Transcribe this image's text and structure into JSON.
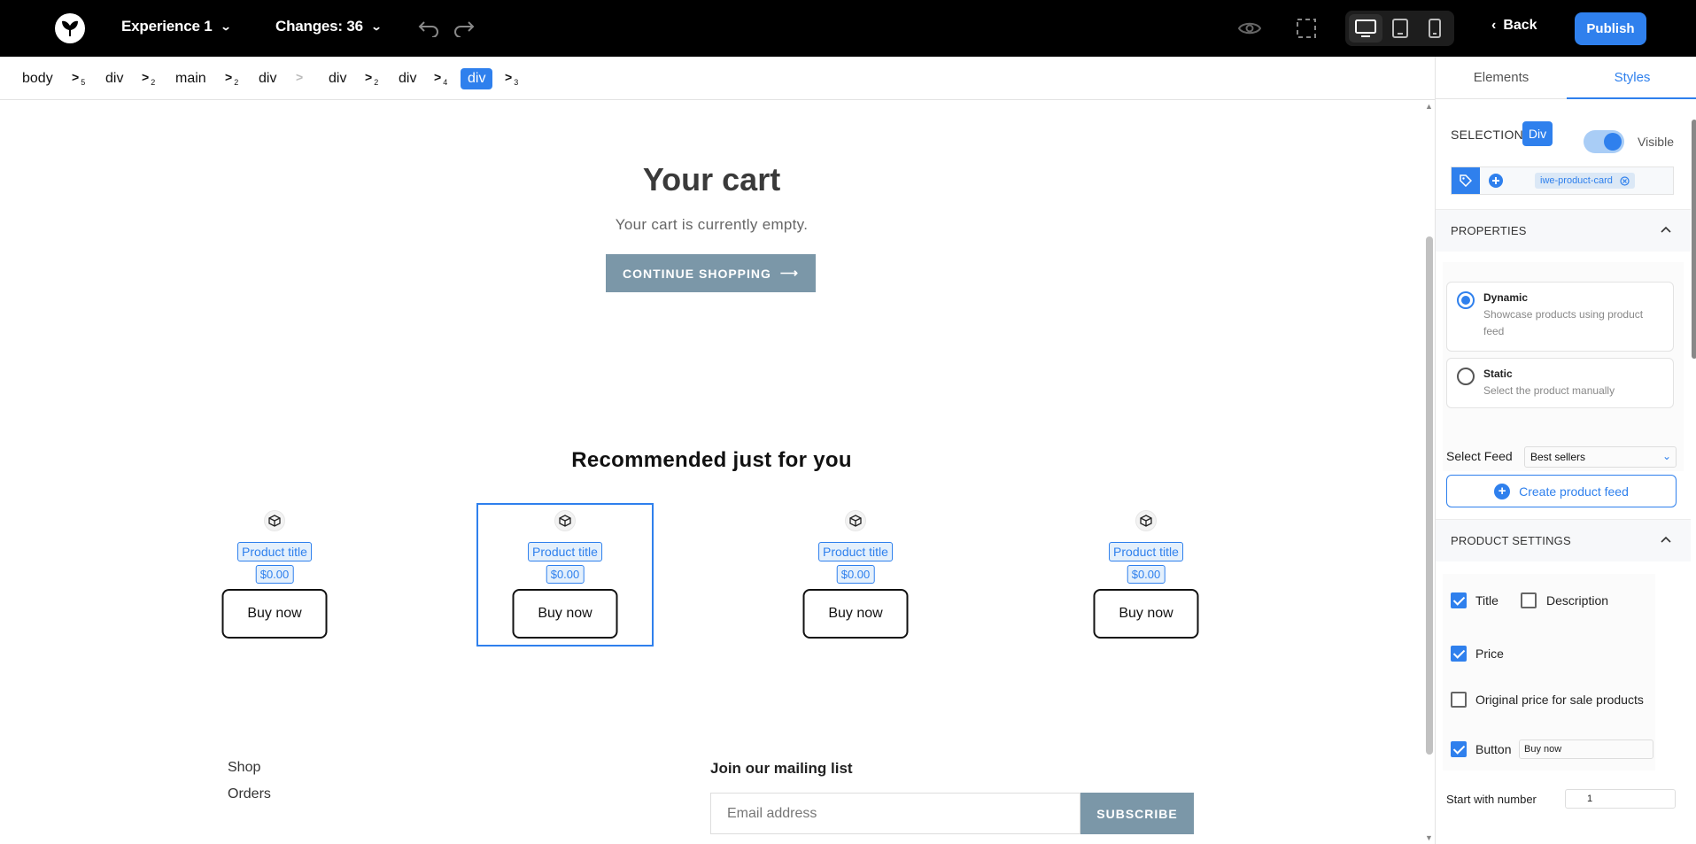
{
  "topbar": {
    "experience_label": "Experience 1",
    "changes_label": "Changes: 36",
    "back_label": "Back",
    "publish_label": "Publish",
    "active_device": "desktop"
  },
  "breadcrumb": {
    "items": [
      "body",
      "div",
      "main",
      "div",
      "div",
      "div",
      "div"
    ],
    "separators": [
      "5",
      "2",
      "2",
      "",
      "2",
      "4",
      "3"
    ]
  },
  "canvas": {
    "cart_title": "Your cart",
    "cart_empty": "Your cart is currently empty.",
    "continue_label": "CONTINUE SHOPPING",
    "continue_arrow": "⟶",
    "recommended_title": "Recommended just for you",
    "products": [
      {
        "title": "Product title",
        "price": "$0.00",
        "button": "Buy now",
        "selected": false
      },
      {
        "title": "Product title",
        "price": "$0.00",
        "button": "Buy now",
        "selected": true
      },
      {
        "title": "Product title",
        "price": "$0.00",
        "button": "Buy now",
        "selected": false
      },
      {
        "title": "Product title",
        "price": "$0.00",
        "button": "Buy now",
        "selected": false
      }
    ],
    "footer_links": [
      "Shop",
      "Orders"
    ],
    "mailing_title": "Join our mailing list",
    "email_placeholder": "Email address",
    "subscribe_label": "SUBSCRIBE"
  },
  "panel": {
    "tabs": [
      "Elements",
      "Styles"
    ],
    "active_tab": "Styles",
    "selection_label": "SELECTION",
    "selection_badge": "Div",
    "visible_label": "Visible",
    "visible_on": true,
    "class_chip": "iwe-product-card",
    "properties_heading": "PROPERTIES",
    "options": [
      {
        "title": "Dynamic",
        "desc": "Showcase products using product feed",
        "selected": true
      },
      {
        "title": "Static",
        "desc": "Select the product manually",
        "selected": false
      }
    ],
    "feed_label": "Select Feed",
    "feed_value": "Best sellers",
    "create_feed_label": "Create product feed",
    "product_settings_heading": "PRODUCT SETTINGS",
    "settings": {
      "title": {
        "label": "Title",
        "checked": true
      },
      "description": {
        "label": "Description",
        "checked": false
      },
      "price": {
        "label": "Price",
        "checked": true
      },
      "original_price": {
        "label": "Original price for sale products",
        "checked": false
      },
      "button": {
        "label": "Button",
        "checked": true
      }
    },
    "button_text_value": "Buy now",
    "start_label": "Start with number",
    "start_value": "1"
  },
  "colors": {
    "accent": "#2f80ed",
    "topbar": "#000000",
    "store_button": "#7b97a8"
  }
}
